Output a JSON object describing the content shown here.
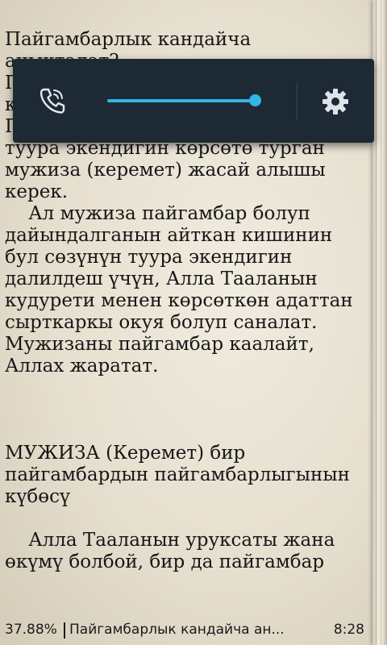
{
  "reader": {
    "paragraphs": [
      "Пайгамбарлык кандайча аныкталат?",
      "Пайгамбарлыкка шарт болгон касиеттерге ээ болуу. Пайгамбармын деген киши анын туура экендигин көрсөтө турган мужиза (керемет) жасай алышы керек.",
      "    Ал мужиза пайгамбар болуп дайындалганын айткан кишинин бул сөзүнүн туура экендигин далилдеш үчүн, Алла Тааланын кудурети менен көрсөткөн адаттан сырткаркы окуя болуп саналат. Мужизаны пайгамбар каалайт, Аллах жаратат.",
      "МУЖИЗА (Керемет) бир пайгамбардын пайгамбарлыгынын күбөсү",
      "    Алла Тааланын уруксаты жана өкүмү болбой, бир да пайгамбар"
    ]
  },
  "quick_panel": {
    "left_icon": "phone-ringer-icon",
    "right_icon": "gear-icon",
    "volume_fraction": 0.92,
    "accent_color": "#33b5e5",
    "background_color": "#1d2a35"
  },
  "status_bar": {
    "progress": "37.88%",
    "book_title": "Пайгамбарлык кандайча ан...",
    "time": "8:28"
  }
}
